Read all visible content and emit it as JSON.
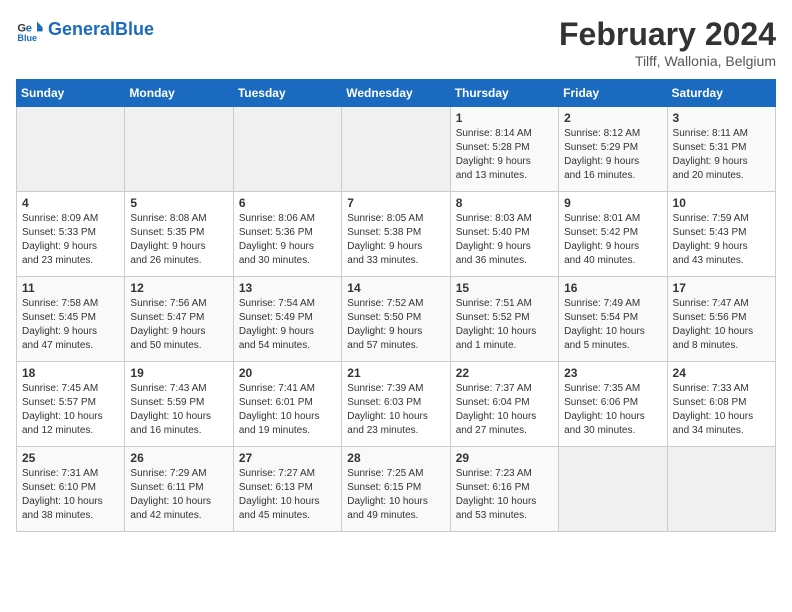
{
  "logo": {
    "text_general": "General",
    "text_blue": "Blue"
  },
  "title": {
    "month_year": "February 2024",
    "location": "Tilff, Wallonia, Belgium"
  },
  "days_of_week": [
    "Sunday",
    "Monday",
    "Tuesday",
    "Wednesday",
    "Thursday",
    "Friday",
    "Saturday"
  ],
  "weeks": [
    [
      {
        "day": "",
        "info": ""
      },
      {
        "day": "",
        "info": ""
      },
      {
        "day": "",
        "info": ""
      },
      {
        "day": "",
        "info": ""
      },
      {
        "day": "1",
        "info": "Sunrise: 8:14 AM\nSunset: 5:28 PM\nDaylight: 9 hours\nand 13 minutes."
      },
      {
        "day": "2",
        "info": "Sunrise: 8:12 AM\nSunset: 5:29 PM\nDaylight: 9 hours\nand 16 minutes."
      },
      {
        "day": "3",
        "info": "Sunrise: 8:11 AM\nSunset: 5:31 PM\nDaylight: 9 hours\nand 20 minutes."
      }
    ],
    [
      {
        "day": "4",
        "info": "Sunrise: 8:09 AM\nSunset: 5:33 PM\nDaylight: 9 hours\nand 23 minutes."
      },
      {
        "day": "5",
        "info": "Sunrise: 8:08 AM\nSunset: 5:35 PM\nDaylight: 9 hours\nand 26 minutes."
      },
      {
        "day": "6",
        "info": "Sunrise: 8:06 AM\nSunset: 5:36 PM\nDaylight: 9 hours\nand 30 minutes."
      },
      {
        "day": "7",
        "info": "Sunrise: 8:05 AM\nSunset: 5:38 PM\nDaylight: 9 hours\nand 33 minutes."
      },
      {
        "day": "8",
        "info": "Sunrise: 8:03 AM\nSunset: 5:40 PM\nDaylight: 9 hours\nand 36 minutes."
      },
      {
        "day": "9",
        "info": "Sunrise: 8:01 AM\nSunset: 5:42 PM\nDaylight: 9 hours\nand 40 minutes."
      },
      {
        "day": "10",
        "info": "Sunrise: 7:59 AM\nSunset: 5:43 PM\nDaylight: 9 hours\nand 43 minutes."
      }
    ],
    [
      {
        "day": "11",
        "info": "Sunrise: 7:58 AM\nSunset: 5:45 PM\nDaylight: 9 hours\nand 47 minutes."
      },
      {
        "day": "12",
        "info": "Sunrise: 7:56 AM\nSunset: 5:47 PM\nDaylight: 9 hours\nand 50 minutes."
      },
      {
        "day": "13",
        "info": "Sunrise: 7:54 AM\nSunset: 5:49 PM\nDaylight: 9 hours\nand 54 minutes."
      },
      {
        "day": "14",
        "info": "Sunrise: 7:52 AM\nSunset: 5:50 PM\nDaylight: 9 hours\nand 57 minutes."
      },
      {
        "day": "15",
        "info": "Sunrise: 7:51 AM\nSunset: 5:52 PM\nDaylight: 10 hours\nand 1 minute."
      },
      {
        "day": "16",
        "info": "Sunrise: 7:49 AM\nSunset: 5:54 PM\nDaylight: 10 hours\nand 5 minutes."
      },
      {
        "day": "17",
        "info": "Sunrise: 7:47 AM\nSunset: 5:56 PM\nDaylight: 10 hours\nand 8 minutes."
      }
    ],
    [
      {
        "day": "18",
        "info": "Sunrise: 7:45 AM\nSunset: 5:57 PM\nDaylight: 10 hours\nand 12 minutes."
      },
      {
        "day": "19",
        "info": "Sunrise: 7:43 AM\nSunset: 5:59 PM\nDaylight: 10 hours\nand 16 minutes."
      },
      {
        "day": "20",
        "info": "Sunrise: 7:41 AM\nSunset: 6:01 PM\nDaylight: 10 hours\nand 19 minutes."
      },
      {
        "day": "21",
        "info": "Sunrise: 7:39 AM\nSunset: 6:03 PM\nDaylight: 10 hours\nand 23 minutes."
      },
      {
        "day": "22",
        "info": "Sunrise: 7:37 AM\nSunset: 6:04 PM\nDaylight: 10 hours\nand 27 minutes."
      },
      {
        "day": "23",
        "info": "Sunrise: 7:35 AM\nSunset: 6:06 PM\nDaylight: 10 hours\nand 30 minutes."
      },
      {
        "day": "24",
        "info": "Sunrise: 7:33 AM\nSunset: 6:08 PM\nDaylight: 10 hours\nand 34 minutes."
      }
    ],
    [
      {
        "day": "25",
        "info": "Sunrise: 7:31 AM\nSunset: 6:10 PM\nDaylight: 10 hours\nand 38 minutes."
      },
      {
        "day": "26",
        "info": "Sunrise: 7:29 AM\nSunset: 6:11 PM\nDaylight: 10 hours\nand 42 minutes."
      },
      {
        "day": "27",
        "info": "Sunrise: 7:27 AM\nSunset: 6:13 PM\nDaylight: 10 hours\nand 45 minutes."
      },
      {
        "day": "28",
        "info": "Sunrise: 7:25 AM\nSunset: 6:15 PM\nDaylight: 10 hours\nand 49 minutes."
      },
      {
        "day": "29",
        "info": "Sunrise: 7:23 AM\nSunset: 6:16 PM\nDaylight: 10 hours\nand 53 minutes."
      },
      {
        "day": "",
        "info": ""
      },
      {
        "day": "",
        "info": ""
      }
    ]
  ]
}
